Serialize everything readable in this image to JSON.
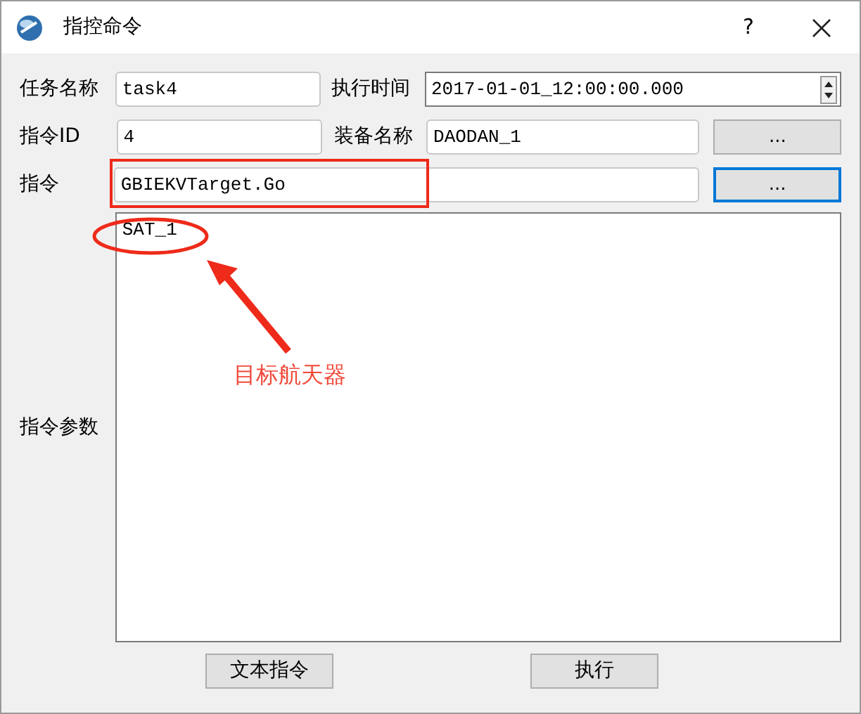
{
  "window": {
    "title": "指控命令",
    "help": "?"
  },
  "form": {
    "task_name": {
      "label": "任务名称",
      "value": "task4"
    },
    "exec_time": {
      "label": "执行时间",
      "value": "2017-01-01_12:00:00.000"
    },
    "command_id": {
      "label": "指令ID",
      "value": "4"
    },
    "equipment": {
      "label": "装备名称",
      "value": "DAODAN_1",
      "browse": "..."
    },
    "command": {
      "label": "指令",
      "value": "GBIEKVTarget.Go",
      "browse": "...",
      "browse_focused": true
    },
    "params": {
      "label": "指令参数",
      "value": "SAT_1"
    }
  },
  "buttons": [
    {
      "label": "文本指令"
    },
    {
      "label": "执行"
    }
  ],
  "annotation": {
    "label": "目标航天器"
  }
}
